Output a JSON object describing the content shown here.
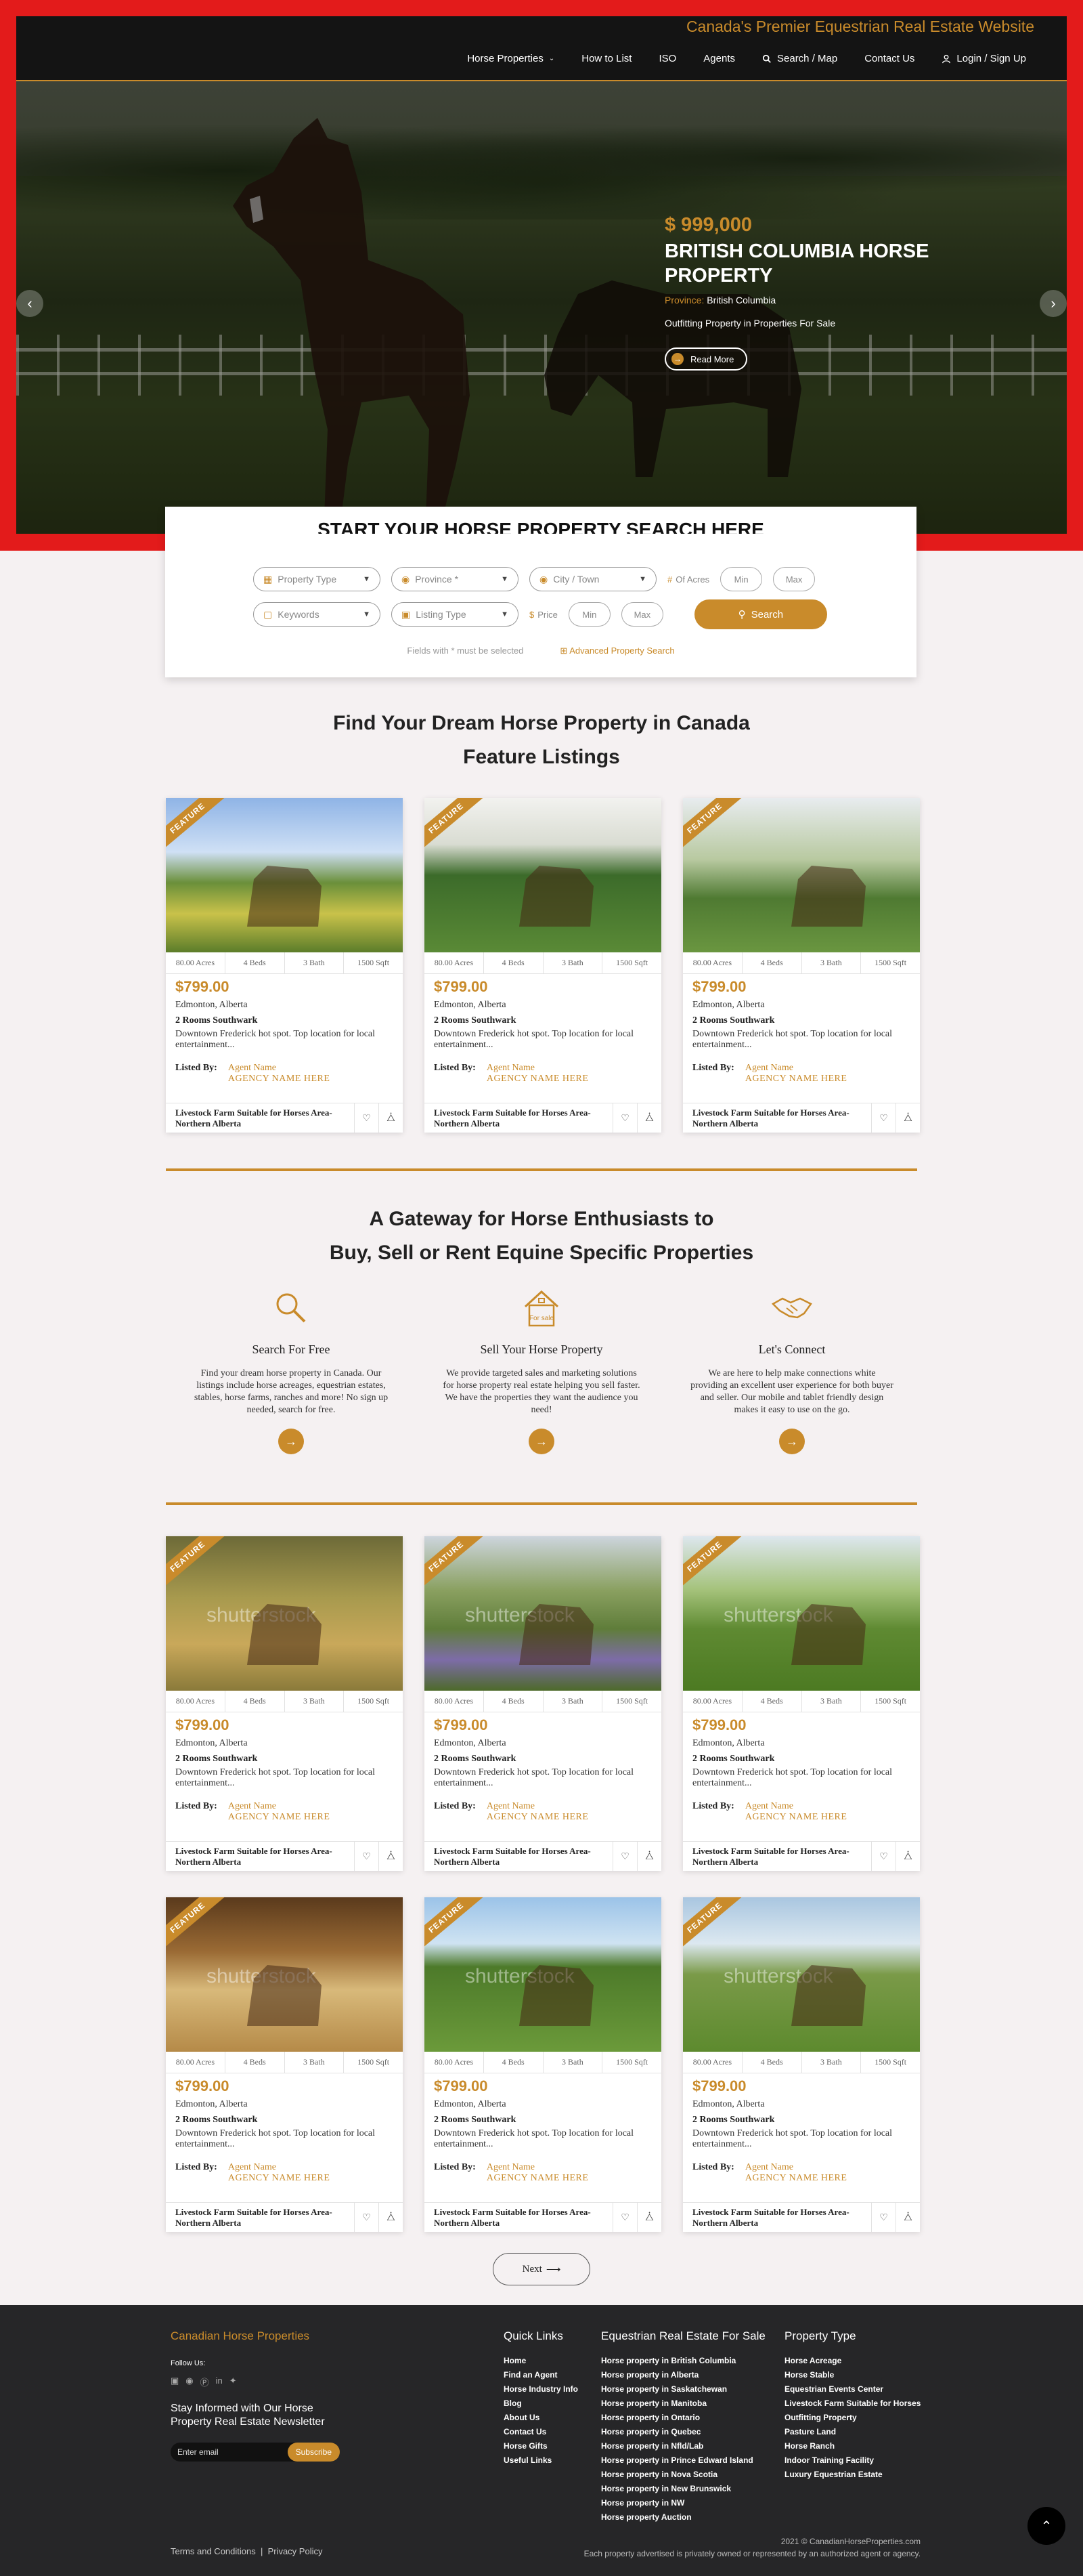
{
  "header": {
    "tagline": "Canada's Premier Equestrian Real Estate Website",
    "nav": [
      {
        "label": "Horse Properties",
        "icon": "chevron-down-icon"
      },
      {
        "label": "How to List"
      },
      {
        "label": "ISO"
      },
      {
        "label": "Agents"
      },
      {
        "label": "Search / Map",
        "icon": "search-icon"
      },
      {
        "label": "Contact Us"
      },
      {
        "label": "Login / Sign Up",
        "icon": "user-icon"
      }
    ]
  },
  "hero": {
    "price": "$ 999,000",
    "title": "BRITISH COLUMBIA HORSE PROPERTY",
    "province_label": "Province:",
    "province_value": "British Columbia",
    "subtitle": "Outfitting Property in Properties For Sale",
    "read_more": "Read More"
  },
  "search": {
    "title": "START YOUR HORSE PROPERTY SEARCH HERE",
    "property_type": "Property Type",
    "province": "Province *",
    "city": "City / Town",
    "acres_label": "Of Acres",
    "acres_min": "Min",
    "acres_max": "Max",
    "keywords": "Keywords",
    "listing_type": "Listing Type",
    "price_label": "Price",
    "price_min": "Min",
    "price_max": "Max",
    "search_button": "Search",
    "required_note": "Fields with * must be selected",
    "advanced": "Advanced Property Search"
  },
  "sections": {
    "find_title": "Find Your Dream Horse Property in Canada",
    "feature_title": "Feature Listings",
    "gateway_line1": "A Gateway for Horse Enthusiasts to",
    "gateway_line2": "Buy, Sell or Rent Equine Specific Properties"
  },
  "features": [
    {
      "name": "Search For Free",
      "icon": "search-icon",
      "text": "Find your dream horse property in Canada. Our listings include horse acreages, equestrian estates, stables, horse farms, ranches and more! No sign up needed, search for free."
    },
    {
      "name": "Sell Your Horse Property",
      "icon": "for-sale-house-icon",
      "icon_text": "For sale",
      "text": "We provide targeted sales and marketing solutions for horse property real estate helping you sell faster. We have the properties they want the audience you need!"
    },
    {
      "name": "Let's Connect",
      "icon": "handshake-icon",
      "text": "We are here to help make connections white providing an excellent user experience for both buyer and seller. Our mobile and tablet friendly design makes it easy to use on the go."
    }
  ],
  "listing_template": {
    "badge": "FEATURE",
    "acres": "80.00 Acres",
    "beds": "4 Beds",
    "bath": "3 Bath",
    "sqft": "1500 Sqft",
    "price": "$799.00",
    "city": "Edmonton, Alberta",
    "rooms": "2 Rooms Southwark",
    "desc": "Downtown Frederick hot spot. Top location for local entertainment...",
    "listed_by": "Listed By:",
    "agent": "Agent Name",
    "agency": "AGENCY NAME HERE",
    "footer": "Livestock Farm Suitable for Horses Area-Northern Alberta"
  },
  "listings": [
    {
      "image": "farm-field-image"
    },
    {
      "image": "horses-running-image"
    },
    {
      "image": "horse-pair-image"
    },
    {
      "image": "horse-meadow-image"
    },
    {
      "image": "garden-estate-image"
    },
    {
      "image": "pasture-barn-image"
    },
    {
      "image": "stable-aisle-image"
    },
    {
      "image": "black-fence-image"
    },
    {
      "image": "grazing-horse-image"
    }
  ],
  "watermark": "shutterstock",
  "pagination": {
    "next": "Next"
  },
  "footer": {
    "brand": "Canadian Horse Properties",
    "follow": "Follow Us:",
    "newsletter": "Stay Informed with Our Horse Property Real Estate Newsletter",
    "email_placeholder": "Enter email",
    "subscribe": "Subscribe",
    "quick_links_title": "Quick Links",
    "quick_links": [
      "Home",
      "Find an Agent",
      "Horse Industry Info",
      "Blog",
      "About Us",
      "Contact Us",
      "Horse Gifts",
      "Useful Links"
    ],
    "equestrian_title": "Equestrian Real Estate For Sale",
    "equestrian": [
      "Horse property in British Columbia",
      "Horse property in Alberta",
      "Horse property in Saskatchewan",
      "Horse property in Manitoba",
      "Horse property in Ontario",
      "Horse property in Quebec",
      "Horse property in Nfld/Lab",
      "Horse property in Prince Edward Island",
      "Horse property in Nova Scotia",
      "Horse property in New Brunswick",
      "Horse property in NW",
      "Horse property Auction"
    ],
    "type_title": "Property Type",
    "types": [
      "Horse Acreage",
      "Horse Stable",
      "Equestrian Events Center",
      "Livestock Farm Suitable for Horses",
      "Outfitting Property",
      "Pasture Land",
      "Horse Ranch",
      "Indoor Training Facility",
      "Luxury Equestrian Estate"
    ],
    "terms": "Terms and Conditions",
    "privacy": "Privacy Policy",
    "copyright": "2021 © CanadianHorseProperties.com",
    "disclaimer": "Each property advertised is privately owned or represented by an authorized agent or agency."
  },
  "colors": {
    "accent": "#c98b2b",
    "hero_frame": "#e31b1b",
    "footer_bg": "#262628"
  }
}
